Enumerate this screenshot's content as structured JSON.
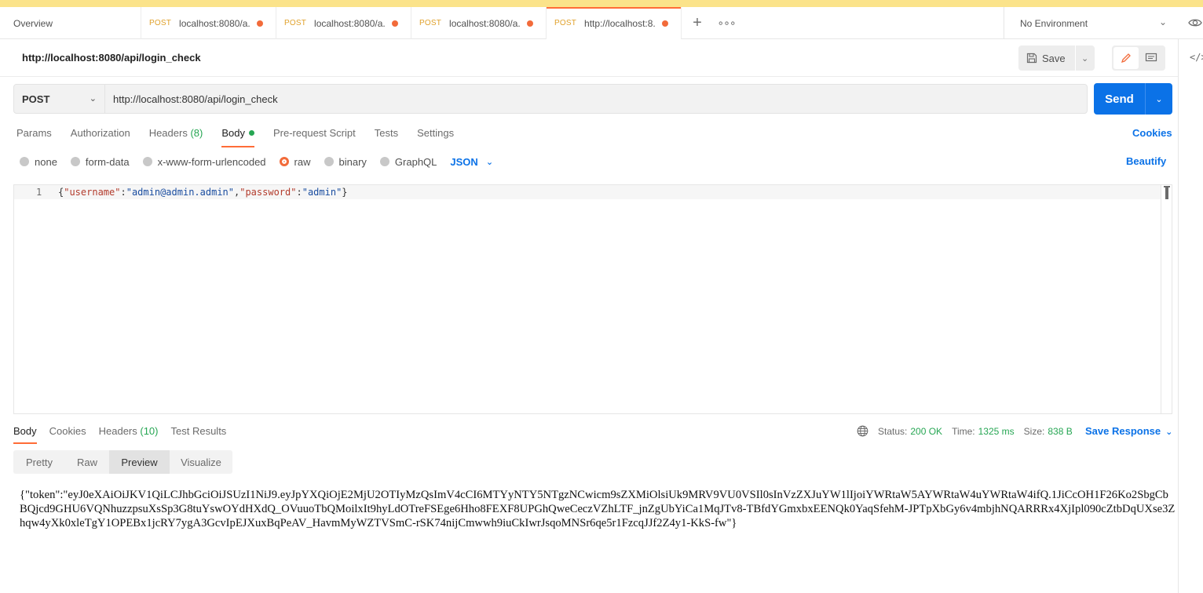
{
  "tabs": {
    "overview": "Overview",
    "items": [
      {
        "method": "POST",
        "title": "localhost:8080/a..."
      },
      {
        "method": "POST",
        "title": "localhost:8080/a..."
      },
      {
        "method": "POST",
        "title": "localhost:8080/a..."
      },
      {
        "method": "POST",
        "title": "http://localhost:8..."
      }
    ],
    "plus": "+",
    "more": "∘∘∘"
  },
  "environment": "No Environment",
  "request": {
    "title": "http://localhost:8080/api/login_check",
    "save_label": "Save",
    "method": "POST",
    "url": "http://localhost:8080/api/login_check",
    "send_label": "Send"
  },
  "subtabs": {
    "params": "Params",
    "authorization": "Authorization",
    "headers": "Headers",
    "headers_count": "(8)",
    "body": "Body",
    "prerequest": "Pre-request Script",
    "tests": "Tests",
    "settings": "Settings",
    "cookies": "Cookies"
  },
  "body_types": {
    "none": "none",
    "form_data": "form-data",
    "urlencoded": "x-www-form-urlencoded",
    "raw": "raw",
    "binary": "binary",
    "graphql": "GraphQL",
    "format": "JSON",
    "beautify": "Beautify"
  },
  "editor": {
    "line_number": "1",
    "brace_open": "{",
    "key1": "\"username\"",
    "colon1": ":",
    "val1": "\"admin@admin.admin\"",
    "comma": ",",
    "key2": "\"password\"",
    "colon2": ":",
    "val2": "\"admin\"",
    "brace_close": "}"
  },
  "response": {
    "tabs": {
      "body": "Body",
      "cookies": "Cookies",
      "headers": "Headers",
      "headers_count": "(10)",
      "test_results": "Test Results"
    },
    "status_label": "Status:",
    "status_value": "200 OK",
    "time_label": "Time:",
    "time_value": "1325 ms",
    "size_label": "Size:",
    "size_value": "838 B",
    "save_response": "Save Response",
    "views": {
      "pretty": "Pretty",
      "raw": "Raw",
      "preview": "Preview",
      "visualize": "Visualize"
    },
    "preview_text": "{\"token\":\"eyJ0eXAiOiJKV1QiLCJhbGciOiJSUzI1NiJ9.eyJpYXQiOjE2MjU2OTIyMzQsImV4cCI6MTYyNTY5NTgzNCwicm9sZXMiOlsiUk9MRV9VU0VSIl0sInVzZXJuYW1lIjoiYWRtaW5AYWRtaW4uYWRtaW4ifQ.1JiCcOH1F26Ko2SbgCbBQjcd9GHU6VQNhuzzpsuXsSp3G8tuYswOYdHXdQ_OVuuoTbQMoilxIt9hyLdOTreFSEge6Hho8FEXF8UPGhQweCeczVZhLTF_jnZgUbYiCa1MqJTv8-TBfdYGmxbxEENQk0YaqSfehM-JPTpXbGy6v4mbjhNQARRRx4XjIpl090cZtbDqUXse3Zhqw4yXk0xleTgY1OPEBx1jcRY7ygA3GcvIpEJXuxBqPeAV_HavmMyWZTVSmC-rSK74nijCmwwh9iuCkIwrJsqoMNSr6qe5r1FzcqJJf2Z4y1-KkS-fw\"}"
  },
  "icons": {
    "accent": "#ff6c37",
    "send_color": "#0b72e7",
    "success": "#26a653"
  }
}
